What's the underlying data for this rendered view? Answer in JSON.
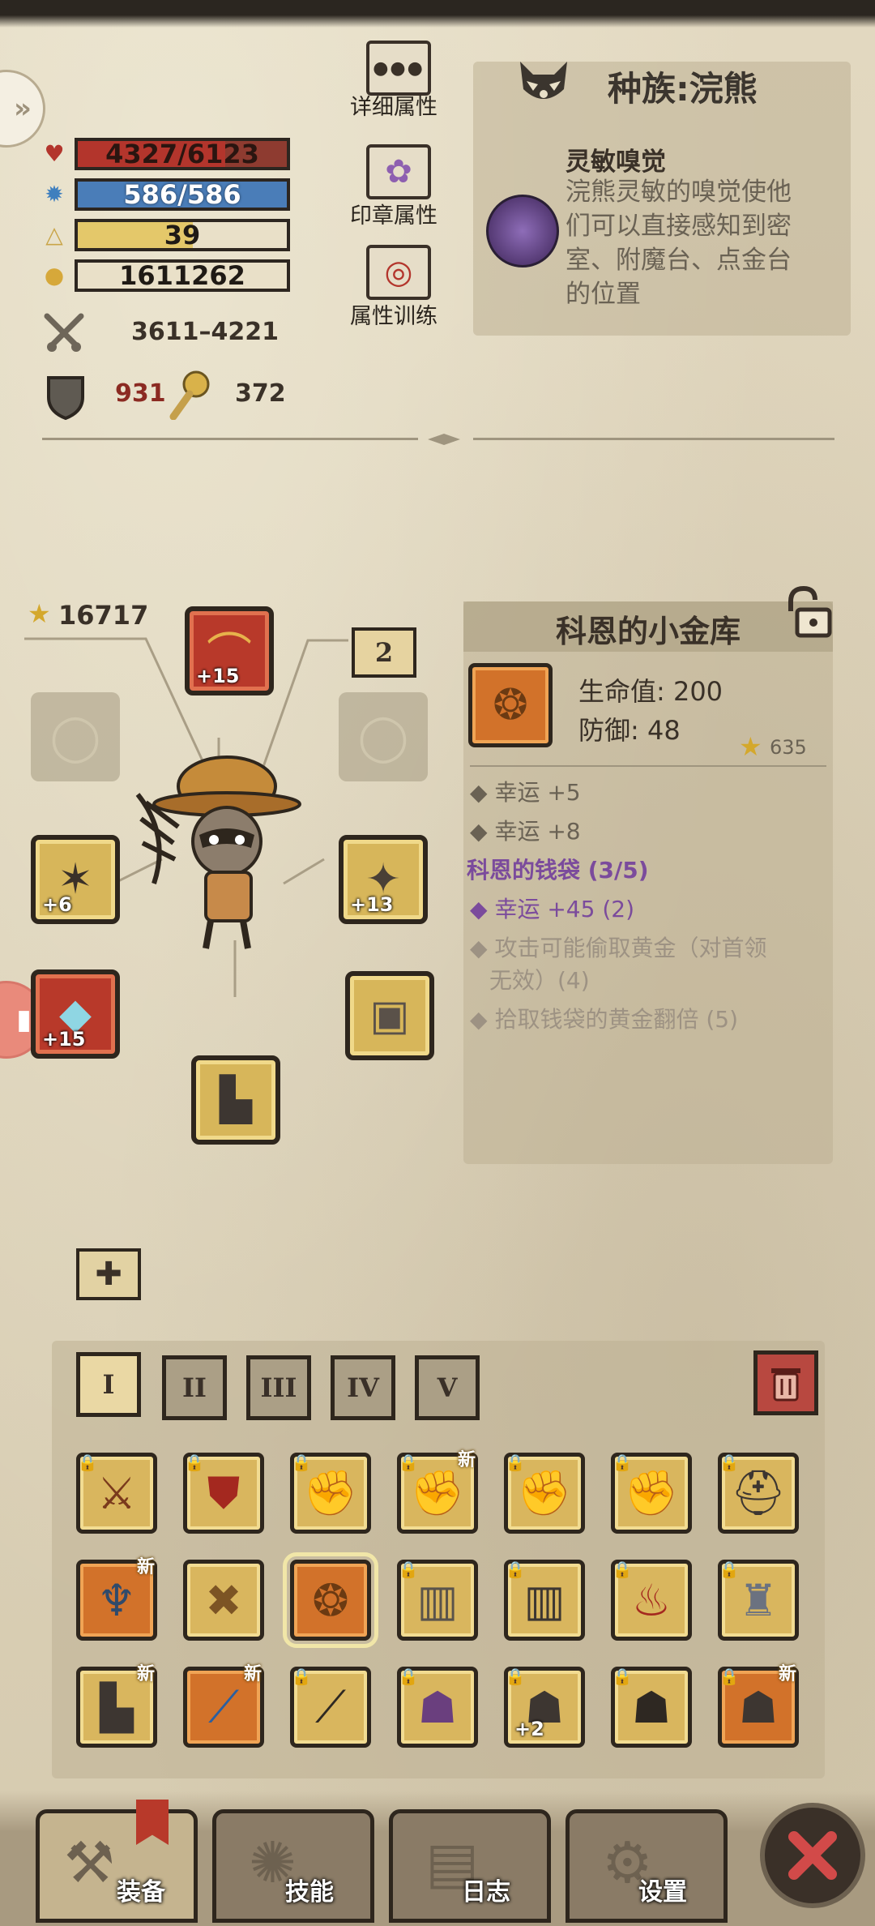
{
  "stats": {
    "hp": {
      "text": "4327/6123",
      "fraction": 0.707,
      "color": "#b3352c"
    },
    "mana": {
      "text": "586/586",
      "fraction": 1.0,
      "color": "#4a7db8"
    },
    "level": {
      "text": "39",
      "fraction": 0.55,
      "color": "#e4c86a"
    },
    "gold": {
      "text": "1611262"
    },
    "attack": "3611–4221",
    "defense": "931",
    "luck": "372"
  },
  "attr_buttons": [
    {
      "label": "详细属性",
      "icon": "dots-icon"
    },
    {
      "label": "印章属性",
      "icon": "seal-icon"
    },
    {
      "label": "属性训练",
      "icon": "target-icon"
    }
  ],
  "race": {
    "title": "种族:浣熊",
    "skill_name": "灵敏嗅觉",
    "skill_desc_lines": [
      "浣熊灵敏的嗅觉使他",
      "们可以直接感知到密",
      "室、附魔台、点金台",
      "的位置"
    ]
  },
  "equipment": {
    "score": "16717",
    "helmet_plus": "+15",
    "page_number": "2",
    "weapon_plus": "+6",
    "offhand_plus": "+13",
    "amulet_plus": "+15"
  },
  "item_detail": {
    "name": "科恩的小金库",
    "hp_line": "生命值: 200",
    "def_line": "防御: 48",
    "score": "635",
    "bonuses": [
      "幸运 +5",
      "幸运 +8"
    ],
    "set_name": "科恩的钱袋 (3/5)",
    "set_effects": [
      {
        "text": "幸运 +45 (2)",
        "active": true
      },
      {
        "text": "攻击可能偷取黄金（对首领",
        "active": false
      },
      {
        "text": "无效）(4)",
        "active": false
      },
      {
        "text": "拾取钱袋的黄金翻倍 (5)",
        "active": false
      }
    ]
  },
  "inventory_tabs": [
    "I",
    "II",
    "III",
    "IV",
    "V"
  ],
  "inventory_new_label": "新",
  "inventory_plus": "+2",
  "nav": [
    {
      "label": "装备",
      "icon": "axe-icon"
    },
    {
      "label": "技能",
      "icon": "skill-icon"
    },
    {
      "label": "日志",
      "icon": "journal-icon"
    },
    {
      "label": "设置",
      "icon": "gear-icon"
    }
  ],
  "colors": {
    "accent_purple": "#7b4b9c",
    "slot_gold": "#d9b65e",
    "slot_red": "#b8392a",
    "close_red": "#d24a49"
  }
}
